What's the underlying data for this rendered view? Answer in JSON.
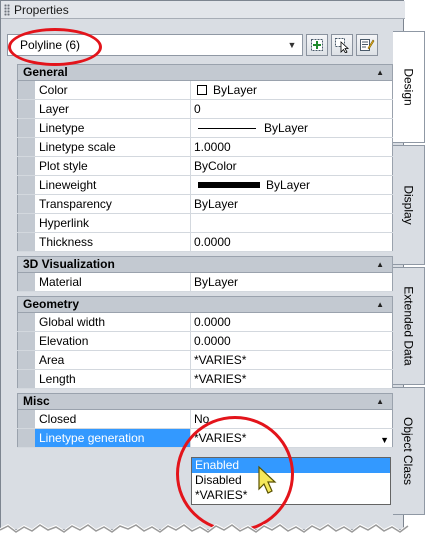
{
  "window": {
    "title": "Properties"
  },
  "object_selector": {
    "value": "Polyline (6)"
  },
  "toolbar_buttons": [
    {
      "icon": "toggle-pickadd-icon"
    },
    {
      "icon": "select-objects-icon"
    },
    {
      "icon": "quick-select-icon"
    }
  ],
  "sections": {
    "general": {
      "title": "General",
      "rows": [
        {
          "name": "Color",
          "value": "ByLayer"
        },
        {
          "name": "Layer",
          "value": "0"
        },
        {
          "name": "Linetype",
          "value": "ByLayer"
        },
        {
          "name": "Linetype scale",
          "value": "1.0000"
        },
        {
          "name": "Plot style",
          "value": "ByColor"
        },
        {
          "name": "Lineweight",
          "value": "ByLayer"
        },
        {
          "name": "Transparency",
          "value": "ByLayer"
        },
        {
          "name": "Hyperlink",
          "value": ""
        },
        {
          "name": "Thickness",
          "value": "0.0000"
        }
      ]
    },
    "visualization": {
      "title": "3D Visualization",
      "rows": [
        {
          "name": "Material",
          "value": "ByLayer"
        }
      ]
    },
    "geometry": {
      "title": "Geometry",
      "rows": [
        {
          "name": "Global width",
          "value": "0.0000"
        },
        {
          "name": "Elevation",
          "value": "0.0000"
        },
        {
          "name": "Area",
          "value": "*VARIES*"
        },
        {
          "name": "Length",
          "value": "*VARIES*"
        }
      ]
    },
    "misc": {
      "title": "Misc",
      "rows": [
        {
          "name": "Closed",
          "value": "No"
        },
        {
          "name": "Linetype generation",
          "value": "*VARIES*"
        }
      ]
    }
  },
  "dropdown_options": [
    "Enabled",
    "Disabled",
    "*VARIES*"
  ],
  "dropdown_highlighted": "Enabled",
  "tabs": [
    "Design",
    "Display",
    "Extended Data",
    "Object Class"
  ],
  "colors": {
    "selection": "#3399ff",
    "callout": "#e3141b",
    "section_header": "#c3c9d1",
    "panel": "#d9dde3"
  }
}
